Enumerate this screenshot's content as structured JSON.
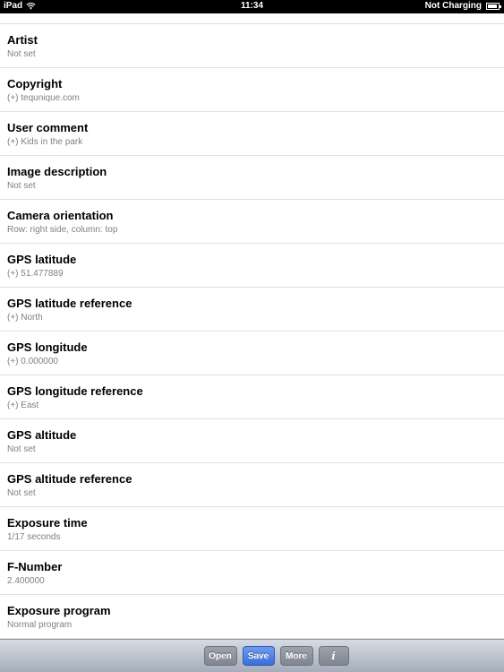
{
  "status_bar": {
    "device": "iPad",
    "time": "11:34",
    "battery_text": "Not Charging",
    "battery_level": 0.95,
    "icons": [
      "wifi-icon",
      "battery-icon"
    ]
  },
  "rows": [
    {
      "title": "Artist",
      "value": "Not set"
    },
    {
      "title": "Copyright",
      "value": "(+) tequnique.com"
    },
    {
      "title": "User comment",
      "value": "(+) Kids in the park"
    },
    {
      "title": "Image description",
      "value": "Not set"
    },
    {
      "title": "Camera orientation",
      "value": "Row: right side, column: top"
    },
    {
      "title": "GPS latitude",
      "value": "(+) 51.477889"
    },
    {
      "title": "GPS latitude reference",
      "value": "(+) North"
    },
    {
      "title": "GPS longitude",
      "value": "(+) 0.000000"
    },
    {
      "title": "GPS longitude reference",
      "value": "(+) East"
    },
    {
      "title": "GPS altitude",
      "value": "Not set"
    },
    {
      "title": "GPS altitude reference",
      "value": "Not set"
    },
    {
      "title": "Exposure time",
      "value": "1/17 seconds"
    },
    {
      "title": "F-Number",
      "value": "2.400000"
    },
    {
      "title": "Exposure program",
      "value": "Normal program"
    }
  ],
  "toolbar": {
    "open_label": "Open",
    "save_label": "Save",
    "more_label": "More",
    "info_label": "i",
    "accent": "#3a6fd9"
  }
}
